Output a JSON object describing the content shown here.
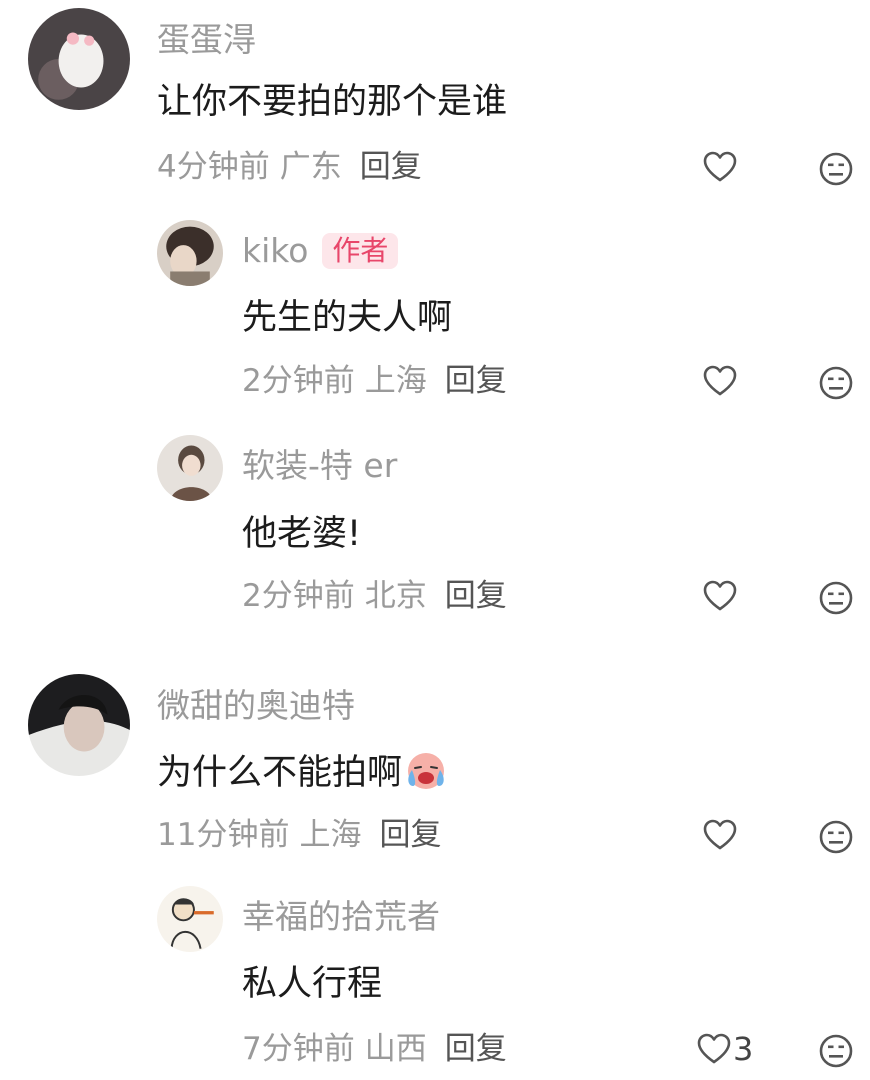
{
  "comments": [
    {
      "username": "蛋蛋淂",
      "text": "让你不要拍的那个是谁",
      "time": "4分钟前",
      "location": "广东",
      "reply": "回复"
    },
    {
      "username": "kiko",
      "badge": "作者",
      "text": "先生的夫人啊",
      "time": "2分钟前",
      "location": "上海",
      "reply": "回复"
    },
    {
      "username": "软装-特 er",
      "text": "他老婆!",
      "time": "2分钟前",
      "location": "北京",
      "reply": "回复"
    },
    {
      "username": "微甜的奥迪特",
      "text": "为什么不能拍啊",
      "emoji": "crying-face-emoji",
      "time": "11分钟前",
      "location": "上海",
      "reply": "回复"
    },
    {
      "username": "幸福的拾荒者",
      "text": "私人行程",
      "time": "7分钟前",
      "location": "山西",
      "reply": "回复",
      "like_count": "3"
    }
  ],
  "icons": {
    "like": "heart-outline-icon",
    "dislike": "neutral-face-icon"
  },
  "colors": {
    "username": "#9a9a9a",
    "text": "#1c1c1c",
    "meta": "#9a9a9a",
    "badge": "#e8466a",
    "badge_bg": "#fde6ea"
  }
}
